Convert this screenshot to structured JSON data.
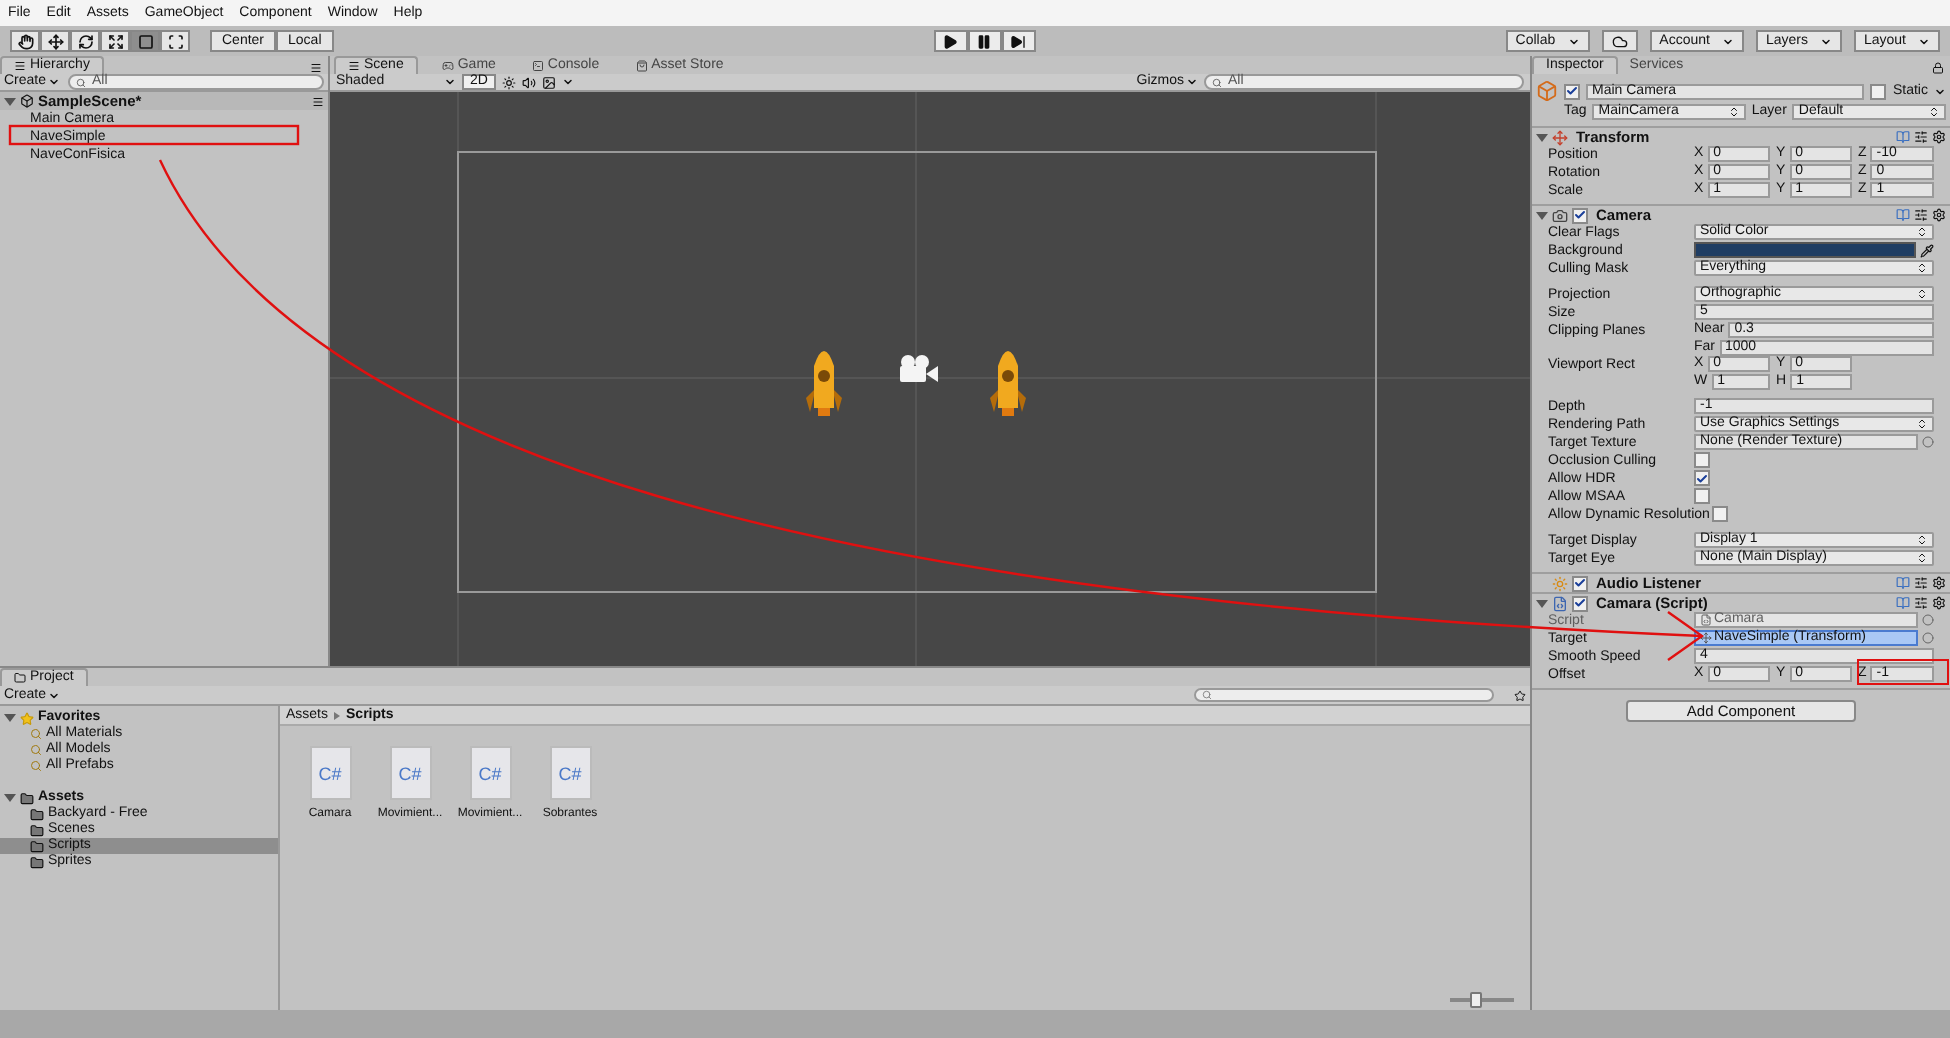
{
  "menu": [
    "File",
    "Edit",
    "Assets",
    "GameObject",
    "Component",
    "Window",
    "Help"
  ],
  "toolbar": {
    "tools": [
      {
        "kind": "hand",
        "selected": false
      },
      {
        "kind": "move",
        "selected": false
      },
      {
        "kind": "rotate",
        "selected": false
      },
      {
        "kind": "scale",
        "selected": false
      },
      {
        "kind": "rect",
        "selected": true
      },
      {
        "kind": "transform",
        "selected": false
      }
    ],
    "pivot": [
      "Center",
      "Local"
    ],
    "playback": [
      {
        "kind": "play",
        "selected": false
      },
      {
        "kind": "pause",
        "selected": false
      },
      {
        "kind": "step",
        "selected": false
      }
    ],
    "right": [
      {
        "kind": "dropdown",
        "label": "Collab"
      },
      {
        "kind": "cloud"
      },
      {
        "kind": "dropdown",
        "label": "Account"
      },
      {
        "kind": "dropdown",
        "label": "Layers"
      },
      {
        "kind": "dropdown",
        "label": "Layout"
      }
    ]
  },
  "hierarchy": {
    "tab": "Hierarchy",
    "create": "Create",
    "search": {
      "placeholder": "All"
    },
    "scene": {
      "name": "SampleScene*",
      "children": [
        {
          "name": "Main Camera",
          "selected": false
        },
        {
          "name": "NaveSimple",
          "selected": false
        },
        {
          "name": "NaveConFisica",
          "selected": false
        }
      ]
    }
  },
  "scene_view": {
    "tabs": [
      {
        "label": "Scene",
        "kind": "scene",
        "selected": true
      },
      {
        "label": "Game",
        "kind": "game",
        "selected": false
      },
      {
        "label": "Console",
        "kind": "console",
        "selected": false
      },
      {
        "label": "Asset Store",
        "kind": "store",
        "selected": false
      }
    ],
    "shading": "Shaded",
    "mode_2d": {
      "label": "2D",
      "on": true
    },
    "gizmos": "Gizmos",
    "search": {
      "placeholder": "All"
    }
  },
  "inspector": {
    "tabs": [
      {
        "label": "Inspector",
        "selected": true
      },
      {
        "label": "Services",
        "selected": false
      }
    ],
    "object": {
      "name": "Main Camera",
      "active": true,
      "static_label": "Static",
      "static": false,
      "tag_label": "Tag",
      "tag": "MainCamera",
      "layer_label": "Layer",
      "layer": "Default"
    },
    "components": [
      {
        "title": "Transform",
        "kind": "transform",
        "groups": [
          [
            {
              "kind": "vector",
              "label": "Position",
              "lines": [
                [
                  {
                    "axis": "X",
                    "value": "0"
                  },
                  {
                    "axis": "Y",
                    "value": "0"
                  },
                  {
                    "axis": "Z",
                    "value": "-10"
                  }
                ]
              ]
            },
            {
              "kind": "vector",
              "label": "Rotation",
              "lines": [
                [
                  {
                    "axis": "X",
                    "value": "0"
                  },
                  {
                    "axis": "Y",
                    "value": "0"
                  },
                  {
                    "axis": "Z",
                    "value": "0"
                  }
                ]
              ]
            },
            {
              "kind": "vector",
              "label": "Scale",
              "lines": [
                [
                  {
                    "axis": "X",
                    "value": "1"
                  },
                  {
                    "axis": "Y",
                    "value": "1"
                  },
                  {
                    "axis": "Z",
                    "value": "1"
                  }
                ]
              ]
            }
          ]
        ]
      },
      {
        "title": "Camera",
        "kind": "camera",
        "enabled": true,
        "groups": [
          [
            {
              "kind": "dropdown",
              "label": "Clear Flags",
              "value": "Solid Color"
            },
            {
              "kind": "color",
              "label": "Background",
              "color": "#1f3d63"
            },
            {
              "kind": "dropdown",
              "label": "Culling Mask",
              "value": "Everything"
            }
          ],
          [
            {
              "kind": "dropdown",
              "label": "Projection",
              "value": "Orthographic"
            },
            {
              "kind": "text",
              "label": "Size",
              "value": "5"
            },
            {
              "kind": "vector",
              "label": "Clipping Planes",
              "lines": [
                [
                  {
                    "axis": "Near",
                    "value": "0.3"
                  }
                ],
                [
                  {
                    "axis": "Far",
                    "value": "1000"
                  }
                ]
              ]
            },
            {
              "kind": "vector",
              "label": "Viewport Rect",
              "lines": [
                [
                  {
                    "axis": "X",
                    "value": "0"
                  },
                  {
                    "axis": "Y",
                    "value": "0"
                  }
                ],
                [
                  {
                    "axis": "W",
                    "value": "1"
                  },
                  {
                    "axis": "H",
                    "value": "1"
                  }
                ]
              ]
            }
          ],
          [
            {
              "kind": "text",
              "label": "Depth",
              "value": "-1"
            },
            {
              "kind": "dropdown",
              "label": "Rendering Path",
              "value": "Use Graphics Settings"
            },
            {
              "kind": "object",
              "label": "Target Texture",
              "value": "None (Render Texture)"
            },
            {
              "kind": "checkbox",
              "label": "Occlusion Culling",
              "checked": false
            },
            {
              "kind": "checkbox",
              "label": "Allow HDR",
              "checked": true
            },
            {
              "kind": "checkbox",
              "label": "Allow MSAA",
              "checked": false
            },
            {
              "kind": "checkbox",
              "label": "Allow Dynamic Resolution",
              "checked": false
            }
          ],
          [
            {
              "kind": "dropdown",
              "label": "Target Display",
              "value": "Display 1"
            },
            {
              "kind": "dropdown",
              "label": "Target Eye",
              "value": "None (Main Display)"
            }
          ]
        ]
      },
      {
        "title": "Audio Listener",
        "kind": "audio",
        "enabled": true
      },
      {
        "title": "Camara (Script)",
        "kind": "script",
        "enabled": true,
        "groups": [
          [
            {
              "kind": "object",
              "label": "Script",
              "value": "Camara",
              "object": {
                "kind": "script"
              },
              "disabled": true
            },
            {
              "kind": "object",
              "label": "Target",
              "value": "NaveSimple (Transform)",
              "object": {
                "kind": "transform"
              },
              "highlighted": true
            },
            {
              "kind": "text",
              "label": "Smooth Speed",
              "value": "4"
            },
            {
              "kind": "vector",
              "label": "Offset",
              "lines": [
                [
                  {
                    "axis": "X",
                    "value": "0"
                  },
                  {
                    "axis": "Y",
                    "value": "0"
                  },
                  {
                    "axis": "Z",
                    "value": "-1"
                  }
                ]
              ]
            }
          ]
        ]
      }
    ],
    "add_button": "Add Component"
  },
  "project": {
    "tab": "Project",
    "create": "Create",
    "tree": [
      {
        "name": "Favorites",
        "kind": "favorites",
        "selected": false,
        "children": [
          {
            "name": "All Materials",
            "kind": "search",
            "selected": false
          },
          {
            "name": "All Models",
            "kind": "search",
            "selected": false
          },
          {
            "name": "All Prefabs",
            "kind": "search",
            "selected": false
          }
        ]
      },
      {
        "name": "Assets",
        "kind": "folder",
        "selected": false,
        "children": [
          {
            "name": "Backyard - Free",
            "kind": "folder",
            "selected": false
          },
          {
            "name": "Scenes",
            "kind": "folder",
            "selected": false
          },
          {
            "name": "Scripts",
            "kind": "folder",
            "selected": true
          },
          {
            "name": "Sprites",
            "kind": "folder",
            "selected": false
          }
        ]
      }
    ],
    "breadcrumb": [
      "Assets",
      "Scripts"
    ],
    "files": [
      {
        "name": "Camara",
        "icon_label": "C#"
      },
      {
        "name": "Movimient...",
        "icon_label": "C#"
      },
      {
        "name": "Movimient...",
        "icon_label": "C#"
      },
      {
        "name": "Sobrantes",
        "icon_label": "C#"
      }
    ],
    "zoom": {
      "level": 0.4
    }
  }
}
